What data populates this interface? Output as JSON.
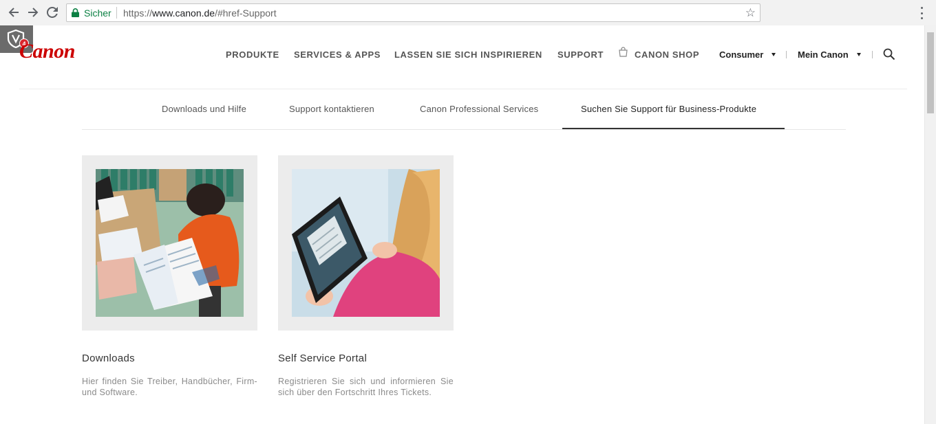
{
  "browser": {
    "secure_label": "Sicher",
    "url_scheme": "https://",
    "url_host": "www.canon.de",
    "url_path": "/#href-Support",
    "extension_badge_count": "4"
  },
  "site": {
    "logo_text": "Canon",
    "nav": {
      "produkte": "PRODUKTE",
      "services": "SERVICES & APPS",
      "inspire": "LASSEN SIE SICH INSPIRIEREN",
      "support": "SUPPORT",
      "shop": "CANON SHOP"
    },
    "segment_dropdown": "Consumer",
    "account_dropdown": "Mein Canon"
  },
  "subnav": {
    "tabs": [
      {
        "label": "Downloads und Hilfe"
      },
      {
        "label": "Support kontaktieren"
      },
      {
        "label": "Canon Professional Services"
      },
      {
        "label": "Suchen Sie Support für Business-Produkte",
        "active": true
      }
    ]
  },
  "cards": [
    {
      "title": "Downloads",
      "description": "Hier finden Sie Treiber, Handbücher, Firm- und Software."
    },
    {
      "title": "Self Service Portal",
      "description": "Registrieren Sie sich und informieren Sie sich über den Fortschritt Ihres Tickets."
    }
  ],
  "colors": {
    "brand_red": "#cc0000",
    "secure_green": "#0b8043",
    "card_bg": "#ececec"
  },
  "icons": {
    "back": "back-arrow-icon",
    "forward": "forward-arrow-icon",
    "reload": "reload-icon",
    "lock": "lock-icon",
    "bookmark": "star-icon",
    "menu": "kebab-menu-icon",
    "shop": "shopping-bag-icon",
    "search": "search-icon",
    "extension": "shield-icon"
  }
}
